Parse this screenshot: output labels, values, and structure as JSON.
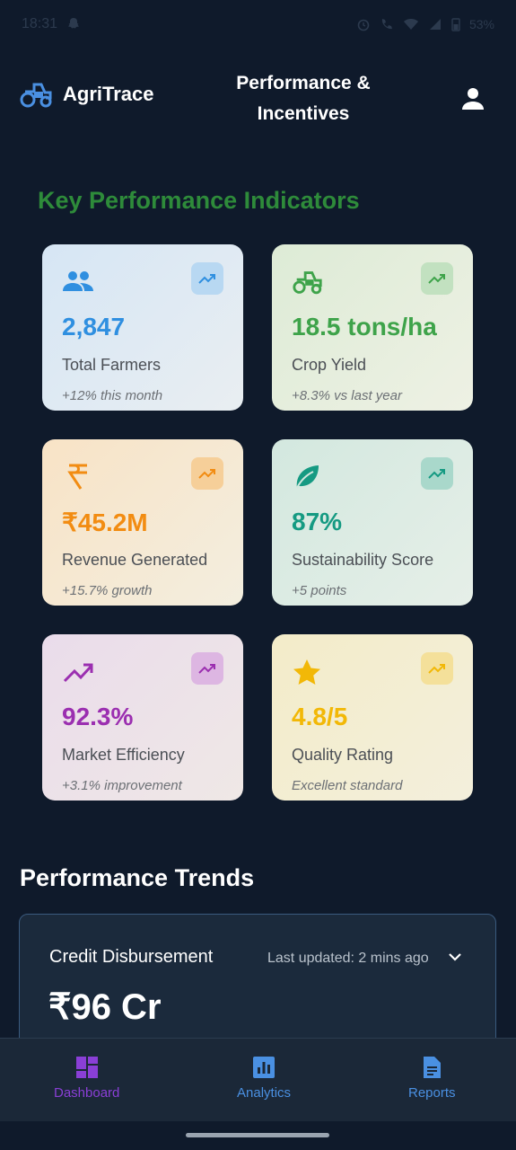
{
  "status_bar": {
    "time": "18:31",
    "battery": "53%"
  },
  "header": {
    "app_name": "AgriTrace",
    "title": "Performance & Incentives"
  },
  "kpi": {
    "heading": "Key Performance Indicators",
    "cards": [
      {
        "value": "2,847",
        "label": "Total Farmers",
        "note": "+12% this month",
        "color": "#2f8fe0",
        "icon": "group-icon"
      },
      {
        "value": "18.5 tons/ha",
        "label": "Crop Yield",
        "note": "+8.3% vs last year",
        "color": "#3ea34a",
        "icon": "tractor-icon"
      },
      {
        "value": "₹45.2M",
        "label": "Revenue Generated",
        "note": "+15.7% growth",
        "color": "#f28c12",
        "icon": "rupee-icon"
      },
      {
        "value": "87%",
        "label": "Sustainability Score",
        "note": "+5 points",
        "color": "#159a82",
        "icon": "leaf-icon"
      },
      {
        "value": "92.3%",
        "label": "Market Efficiency",
        "note": "+3.1% improvement",
        "color": "#9b2fb0",
        "icon": "trending-up-icon"
      },
      {
        "value": "4.8/5",
        "label": "Quality Rating",
        "note": "Excellent standard",
        "color": "#f2b807",
        "icon": "star-icon"
      }
    ]
  },
  "trends": {
    "heading": "Performance Trends",
    "credit": {
      "title": "Credit Disbursement",
      "updated": "Last updated: 2 mins ago",
      "value": "₹96 Cr"
    }
  },
  "nav": {
    "dashboard": "Dashboard",
    "analytics": "Analytics",
    "reports": "Reports"
  }
}
